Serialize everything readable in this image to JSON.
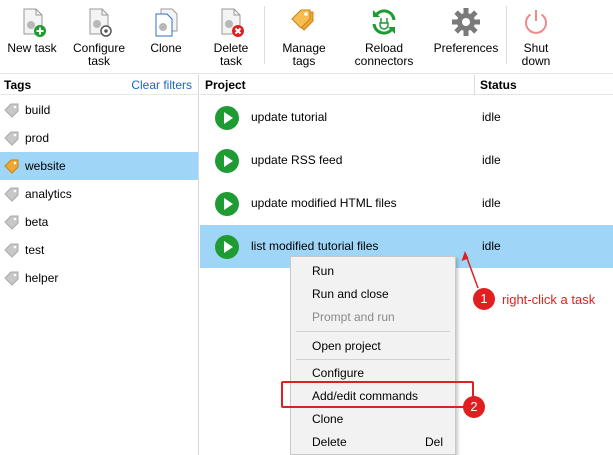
{
  "toolbar": {
    "new_task": "New task",
    "configure_task": "Configure\ntask",
    "clone": "Clone",
    "delete_task": "Delete\ntask",
    "manage_tags": "Manage\ntags",
    "reload_connectors": "Reload\nconnectors",
    "preferences": "Preferences",
    "shut_down": "Shut\ndown"
  },
  "tags_panel": {
    "title": "Tags",
    "clear_filters": "Clear filters",
    "items": [
      {
        "label": "build"
      },
      {
        "label": "prod"
      },
      {
        "label": "website"
      },
      {
        "label": "analytics"
      },
      {
        "label": "beta"
      },
      {
        "label": "test"
      },
      {
        "label": "helper"
      }
    ]
  },
  "projects": {
    "col_project": "Project",
    "col_status": "Status",
    "rows": [
      {
        "name": "update tutorial",
        "status": "idle"
      },
      {
        "name": "update RSS feed",
        "status": "idle"
      },
      {
        "name": "update modified HTML files",
        "status": "idle"
      },
      {
        "name": "list modified tutorial files",
        "status": "idle"
      }
    ]
  },
  "context_menu": {
    "run": "Run",
    "run_and_close": "Run and close",
    "prompt_and_run": "Prompt and run",
    "open_project": "Open project",
    "configure": "Configure",
    "add_edit_commands": "Add/edit commands",
    "clone": "Clone",
    "delete": "Delete",
    "delete_shortcut": "Del"
  },
  "annotations": {
    "step1": "1",
    "step1_text": "right-click a task",
    "step2": "2"
  },
  "colors": {
    "selection": "#9fd5f7",
    "accent_red": "#e02020",
    "play_green": "#1e9b33",
    "link_blue": "#1a66c8",
    "tag_selected": "#f0a830"
  }
}
